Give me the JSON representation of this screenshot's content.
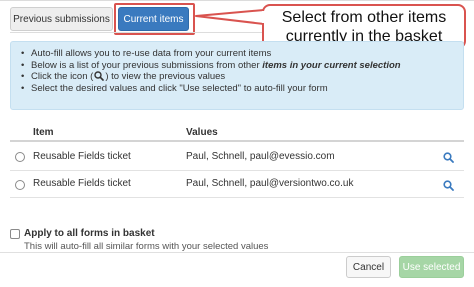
{
  "tabs": {
    "previous_label": "Previous submissions",
    "current_label": "Current items"
  },
  "callout": {
    "line1": "Select from other items",
    "line2": "currently in the basket"
  },
  "info": {
    "line1": "Auto-fill allows you to re-use data from your current items",
    "line2_pre": "Below is a list of your previous submissions from other ",
    "line2_em": "items in your current selection",
    "line3_pre": "Click the icon (",
    "line3_post": ") to view the previous values",
    "line4": "Select the desired values and click \"Use selected\" to auto-fill your form"
  },
  "table": {
    "headers": {
      "item": "Item",
      "values": "Values"
    },
    "rows": [
      {
        "item": "Reusable Fields ticket",
        "values": "Paul, Schnell, paul@evessio.com"
      },
      {
        "item": "Reusable Fields ticket",
        "values": "Paul, Schnell, paul@versiontwo.co.uk"
      }
    ]
  },
  "apply": {
    "label": "Apply to all forms in basket",
    "help": "This will auto-fill all similar forms with your selected values"
  },
  "buttons": {
    "cancel": "Cancel",
    "use_selected": "Use selected"
  },
  "colors": {
    "accent": "#3a7abf",
    "highlight": "#d9534f",
    "info_bg": "#d9ecf7",
    "success_disabled": "#a6d6a6"
  },
  "icons": {
    "search": "magnifier-icon"
  }
}
